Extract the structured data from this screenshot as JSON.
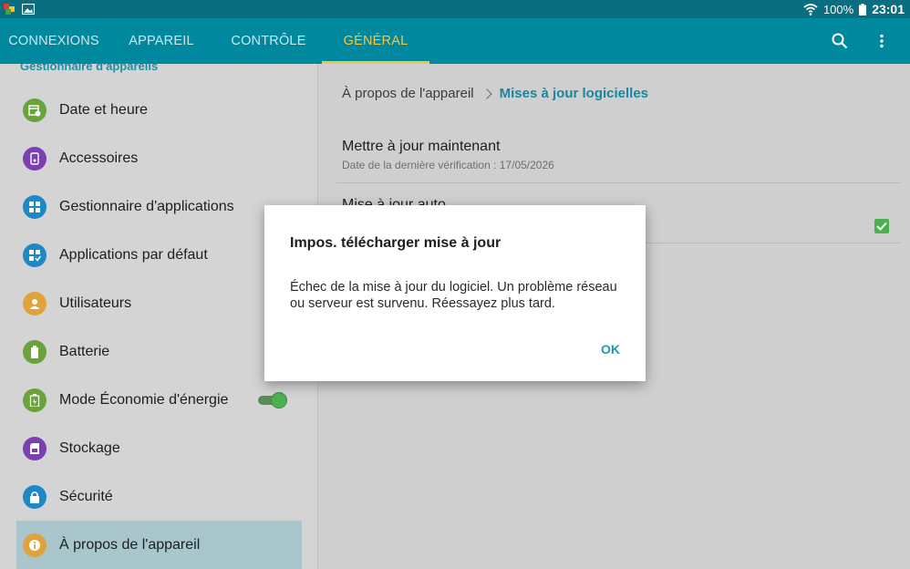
{
  "status_bar": {
    "battery": "100%",
    "time": "23:01"
  },
  "tabs": [
    {
      "label": "CONNEXIONS",
      "active": false
    },
    {
      "label": "APPAREIL",
      "active": false
    },
    {
      "label": "CONTRÔLE",
      "active": false
    },
    {
      "label": "GÉNÉRAL",
      "active": true
    }
  ],
  "sidebar": {
    "section_header": "Gestionnaire d'appareils",
    "items": [
      {
        "label": "Date et heure",
        "icon": "calendar-clock-icon",
        "color": "#6aa33b"
      },
      {
        "label": "Accessoires",
        "icon": "accessory-icon",
        "color": "#7b3fb3"
      },
      {
        "label": "Gestionnaire d'applications",
        "icon": "apps-grid-icon",
        "color": "#1e88c7"
      },
      {
        "label": "Applications par défaut",
        "icon": "default-apps-icon",
        "color": "#1e88c7"
      },
      {
        "label": "Utilisateurs",
        "icon": "users-icon",
        "color": "#e0a23b"
      },
      {
        "label": "Batterie",
        "icon": "battery-icon",
        "color": "#6aa33b"
      },
      {
        "label": "Mode Économie d'énergie",
        "icon": "power-saving-icon",
        "color": "#6aa33b"
      },
      {
        "label": "Stockage",
        "icon": "storage-icon",
        "color": "#7b3fb3"
      },
      {
        "label": "Sécurité",
        "icon": "lock-icon",
        "color": "#1e88c7"
      },
      {
        "label": "À propos de l'appareil",
        "icon": "info-icon",
        "color": "#e0a23b"
      }
    ]
  },
  "main": {
    "breadcrumb": [
      "À propos de l'appareil",
      "Mises à jour logicielles"
    ],
    "settings": [
      {
        "title": "Mettre à jour maintenant",
        "subtitle": "Date de la dernière vérification : 17/05/2026"
      },
      {
        "title": "Mise à jour auto"
      }
    ]
  },
  "dialog": {
    "title": "Impos. télécharger mise à jour",
    "message": "Échec de la mise à jour du logiciel. Un problème réseau ou serveur est survenu. Réessayez plus tard.",
    "ok_label": "OK"
  },
  "colors": {
    "accent": "#00899e",
    "active_tab": "#f4c543",
    "link": "#1a86a0",
    "check_green": "#4caf50"
  }
}
